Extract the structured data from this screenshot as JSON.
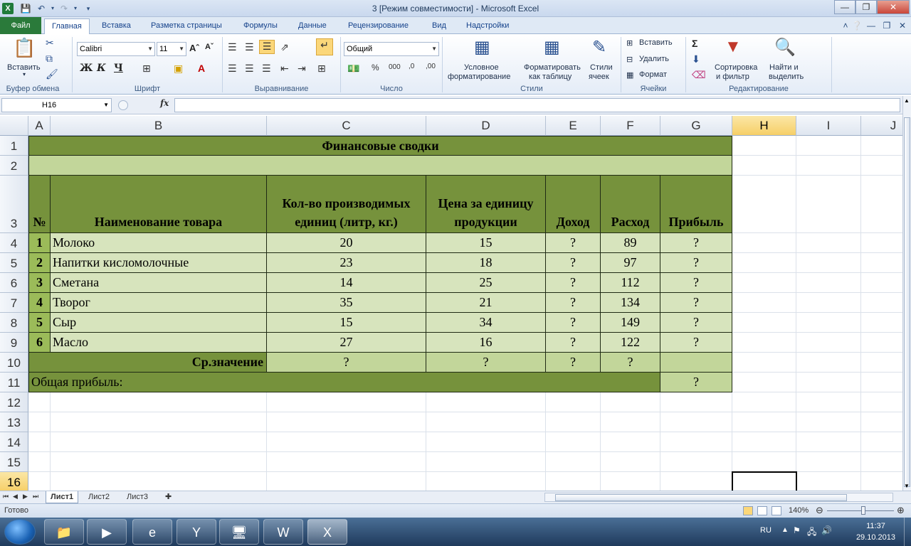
{
  "window": {
    "title": "3  [Режим совместимости]  -  Microsoft Excel"
  },
  "ribbon_tabs": [
    "Файл",
    "Главная",
    "Вставка",
    "Разметка страницы",
    "Формулы",
    "Данные",
    "Рецензирование",
    "Вид",
    "Надстройки"
  ],
  "ribbon": {
    "paste_label": "Вставить",
    "clipboard_label": "Буфер обмена",
    "font_name": "Calibri",
    "font_size": "11",
    "font_group_label": "Шрифт",
    "align_group_label": "Выравнивание",
    "number_format": "Общий",
    "number_group_label": "Число",
    "cond_format_label_1": "Условное",
    "cond_format_label_2": "форматирование",
    "format_table_label_1": "Форматировать",
    "format_table_label_2": "как таблицу",
    "cell_styles_label_1": "Стили",
    "cell_styles_label_2": "ячеек",
    "styles_group_label": "Стили",
    "insert_label": "Вставить",
    "delete_label": "Удалить",
    "format_label": "Формат",
    "cells_group_label": "Ячейки",
    "sort_label_1": "Сортировка",
    "sort_label_2": "и фильтр",
    "find_label_1": "Найти и",
    "find_label_2": "выделить",
    "editing_group_label": "Редактирование"
  },
  "formula_bar": {
    "name_box": "H16",
    "fx": "fx",
    "formula": ""
  },
  "columns": [
    "A",
    "B",
    "C",
    "D",
    "E",
    "F",
    "G",
    "H",
    "I",
    "J"
  ],
  "rows": [
    "1",
    "2",
    "3",
    "4",
    "5",
    "6",
    "7",
    "8",
    "9",
    "10",
    "11",
    "12",
    "13",
    "14",
    "15",
    "16"
  ],
  "sheet": {
    "title": "Финансовые сводки",
    "headers": [
      "№",
      "Наименование товара",
      "Кол-во производимых единиц (литр, кг.)",
      "Цена за единицу продукции",
      "Доход",
      "Расход",
      "Прибыль"
    ],
    "data_rows": [
      [
        "1",
        "Молоко",
        "20",
        "15",
        "?",
        "89",
        "?"
      ],
      [
        "2",
        "Напитки кисломолочные",
        "23",
        "18",
        "?",
        "97",
        "?"
      ],
      [
        "3",
        "Сметана",
        "14",
        "25",
        "?",
        "112",
        "?"
      ],
      [
        "4",
        "Творог",
        "35",
        "21",
        "?",
        "134",
        "?"
      ],
      [
        "5",
        "Сыр",
        "15",
        "34",
        "?",
        "149",
        "?"
      ],
      [
        "6",
        "Масло",
        "27",
        "16",
        "?",
        "122",
        "?"
      ]
    ],
    "avg_label": "Ср.значение",
    "avg_values": [
      "?",
      "?",
      "?",
      "?"
    ],
    "total_label": "Общая прибыль:",
    "total_value": "?"
  },
  "sheet_tabs": [
    "Лист1",
    "Лист2",
    "Лист3"
  ],
  "status": {
    "ready": "Готово",
    "zoom": "140%"
  },
  "taskbar": {
    "lang": "RU",
    "time": "11:37",
    "date": "29.10.2013"
  },
  "colors": {
    "dark_green": "#76923c",
    "mid_green": "#c2d69a",
    "light_green": "#d7e4bd",
    "num_green": "#9bbb59",
    "file_tab": "#2a7a3a"
  }
}
